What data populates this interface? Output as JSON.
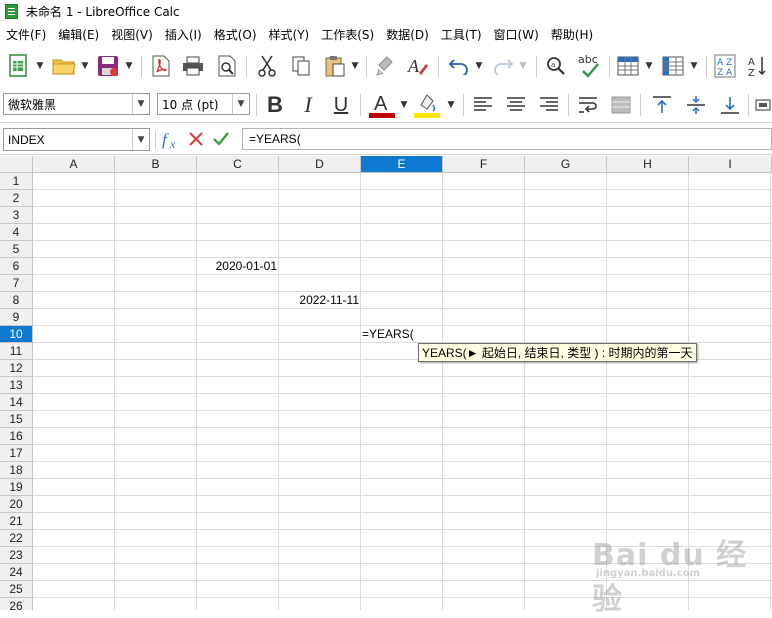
{
  "window": {
    "title": "未命名 1 - LibreOffice Calc"
  },
  "menu": [
    "文件(F)",
    "编辑(E)",
    "视图(V)",
    "插入(I)",
    "格式(O)",
    "样式(Y)",
    "工作表(S)",
    "数据(D)",
    "工具(T)",
    "窗口(W)",
    "帮助(H)"
  ],
  "format_bar": {
    "font_name": "微软雅黑",
    "font_size": "10 点 (pt)"
  },
  "formula_bar": {
    "name_box": "INDEX",
    "formula": "=YEARS("
  },
  "sheet": {
    "columns": [
      "A",
      "B",
      "C",
      "D",
      "E",
      "F",
      "G",
      "H",
      "I"
    ],
    "rows": [
      "1",
      "2",
      "3",
      "4",
      "5",
      "6",
      "7",
      "8",
      "9",
      "10",
      "11",
      "12",
      "13",
      "14",
      "15",
      "16",
      "17",
      "18",
      "19",
      "20",
      "21",
      "22",
      "23",
      "24",
      "25",
      "26"
    ],
    "selected_column": "E",
    "selected_row": "10",
    "cells": {
      "C6": "2020-01-01",
      "D8": "2022-11-11",
      "E10": "=YEARS("
    }
  },
  "tooltip": "YEARS(► 起始日, 结束日, 类型 ) : 时期内的第一天",
  "watermark": {
    "main": "Bai du 经验",
    "sub": "jingyan.baidu.com"
  },
  "colors": {
    "selection": "#0d79d1",
    "tooltip_bg": "#ffffe1",
    "font_color": "#c00000",
    "highlight": "#ffe600"
  }
}
